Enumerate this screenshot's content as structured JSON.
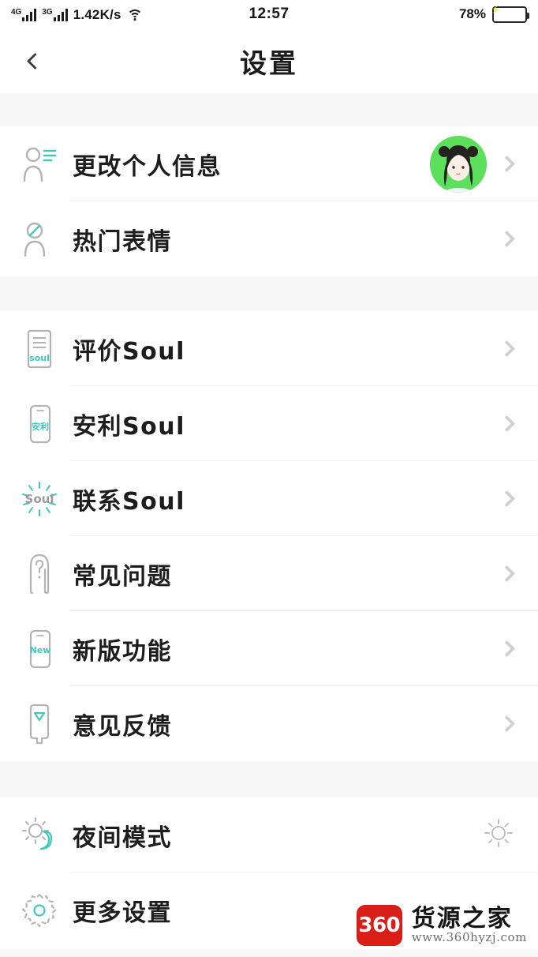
{
  "colors": {
    "accent_teal": "#3ec9bd",
    "icon_gray": "#b4b4b4",
    "text": "#1d1d1d",
    "chevron": "#d0d0d0",
    "avatar_green": "#5ce05c",
    "battery_green": "#2ade6a",
    "watermark_red": "#d81e16",
    "spacer_gray": "#f7f7f8",
    "divider": "#efefef"
  },
  "statusbar": {
    "network_4g": "4G",
    "network_3g": "3G",
    "speed": "1.42K/s",
    "wifi_icon": "wifi-icon",
    "time": "12:57",
    "battery_percent": "78%",
    "battery_icon": "battery-charging-icon"
  },
  "header": {
    "back_icon": "back-chevron-icon",
    "title": "设置"
  },
  "groups": [
    {
      "id": "profile-group",
      "rows": [
        {
          "id": "change-personal-info",
          "icon": "person-info-icon",
          "label": "更改个人信息",
          "has_avatar": true,
          "avatar_alt": "用户头像",
          "accessory": "chevron-right-icon"
        },
        {
          "id": "popular-emoji",
          "icon": "person-emoji-icon",
          "label": "热门表情",
          "has_avatar": false,
          "accessory": "chevron-right-icon"
        }
      ]
    },
    {
      "id": "soul-group",
      "rows": [
        {
          "id": "rate-soul",
          "icon": "soul-document-icon",
          "icon_text": "soul",
          "label": "评价Soul",
          "has_avatar": false,
          "accessory": "chevron-right-icon"
        },
        {
          "id": "recommend-soul",
          "icon": "phone-anli-icon",
          "icon_text": "安利",
          "label": "安利Soul",
          "has_avatar": false,
          "accessory": "chevron-right-icon"
        },
        {
          "id": "contact-soul",
          "icon": "soul-burst-icon",
          "icon_text": "Soul",
          "label": "联系Soul",
          "has_avatar": false,
          "accessory": "chevron-right-icon"
        },
        {
          "id": "faq",
          "icon": "question-bubble-icon",
          "label": "常见问题",
          "has_avatar": false,
          "accessory": "chevron-right-icon"
        },
        {
          "id": "new-features",
          "icon": "phone-new-icon",
          "icon_text": "New",
          "label": "新版功能",
          "has_avatar": false,
          "accessory": "chevron-right-icon"
        },
        {
          "id": "feedback",
          "icon": "feedback-bubble-icon",
          "label": "意见反馈",
          "has_avatar": false,
          "accessory": "chevron-right-icon"
        }
      ]
    },
    {
      "id": "system-group",
      "rows": [
        {
          "id": "night-mode",
          "icon": "sun-moon-icon",
          "label": "夜间模式",
          "has_avatar": false,
          "accessory": "brightness-sun-icon"
        },
        {
          "id": "more-settings",
          "icon": "gear-icon",
          "label": "更多设置",
          "has_avatar": false,
          "accessory": "chevron-right-icon"
        }
      ]
    }
  ],
  "watermark": {
    "badge": "360",
    "name": "货源之家",
    "url": "www.360hyzj.com"
  }
}
